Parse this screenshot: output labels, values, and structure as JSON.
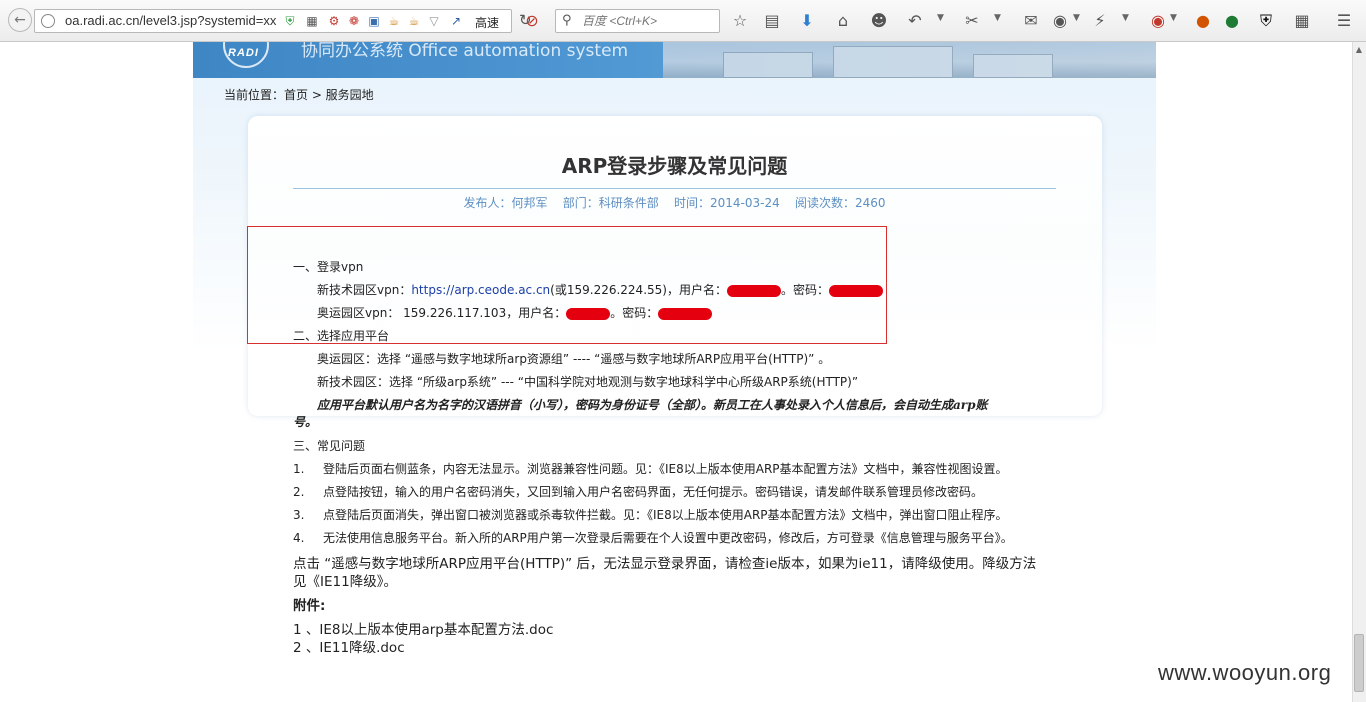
{
  "browser": {
    "url": "oa.radi.ac.cn/level3.jsp?systemid=xx",
    "speed_label": "高速",
    "search_placeholder": "百度 <Ctrl+K>"
  },
  "banner": {
    "logo_text": "RADI",
    "title": "协同办公系统  Office automation system"
  },
  "breadcrumb": "当前位置：首页 > 服务园地",
  "article": {
    "title": "ARP登录步骤及常见问题",
    "meta": "发布人：何邦军    部门：科研条件部    时间：2014-03-24    阅读次数：2460",
    "sec1_heading": "一、登录vpn",
    "vpn1_prefix": "新技术园区vpn：",
    "vpn1_link": "https://arp.ceode.ac.cn",
    "vpn1_suffix": "(或159.226.224.55)，用户名：",
    "pwd_label": "。密码：",
    "vpn2_prefix": "奥运园区vpn：  159.226.117.103，用户名：",
    "sec2_heading": "二、选择应用平台",
    "platform1": "奥运园区：选择 “遥感与数字地球所arp资源组” ---- “遥感与数字地球所ARP应用平台(HTTP)” 。",
    "platform2": "新技术园区：选择 “所级arp系统” --- “中国科学院对地观测与数字地球科学中心所级ARP系统(HTTP)”",
    "note_line1": "应用平台默认用户名为名字的汉语拼音（小写），密码为身份证号（全部）。新员工在人事处录入个人信息后，会自动生成arp账",
    "note_line2": "号。",
    "sec3_heading": "三、常见问题",
    "faq": [
      {
        "num": "1.",
        "text": "登陆后页面右侧蓝条，内容无法显示。浏览器兼容性问题。见：《IE8以上版本使用ARP基本配置方法》文档中，兼容性视图设置。"
      },
      {
        "num": "2.",
        "text": "点登陆按钮，输入的用户名密码消失，又回到输入用户名密码界面，无任何提示。密码错误，请发邮件联系管理员修改密码。"
      },
      {
        "num": "3.",
        "text": "点登陆后页面消失，弹出窗口被浏览器或杀毒软件拦截。见：《IE8以上版本使用ARP基本配置方法》文档中，弹出窗口阻止程序。"
      },
      {
        "num": "4.",
        "text": "无法使用信息服务平台。新入所的ARP用户第一次登录后需要在个人设置中更改密码，修改后，方可登录《信息管理与服务平台》。"
      }
    ],
    "ie_note_line1": "点击 “遥感与数字地球所ARP应用平台(HTTP)” 后，无法显示登录界面，请检查ie版本，如果为ie11，请降级使用。降级方法",
    "ie_note_line2": "见《IE11降级》。",
    "attachments_heading": "附件:",
    "attachments": [
      "1 、IE8以上版本使用arp基本配置方法.doc",
      "2 、IE11降级.doc"
    ]
  },
  "watermark": "www.wooyun.org",
  "colors": {
    "banner_blue": "#4f98d4",
    "meta_blue": "#5d8fc2",
    "link_blue": "#1c3fa8",
    "highlight_red": "#d8302f",
    "redaction_red": "#e5000f"
  }
}
